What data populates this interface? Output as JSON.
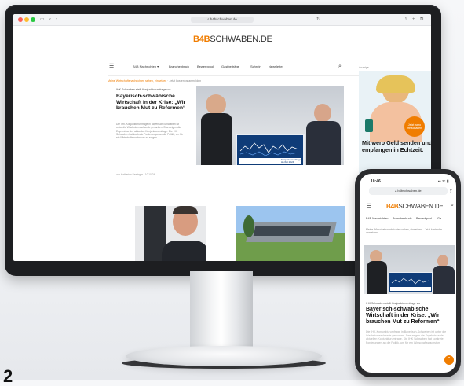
{
  "browser": {
    "url": "b4bschwaben.de"
  },
  "site": {
    "logo_mark": "B4B",
    "logo_name": "SCHWABEN.DE",
    "nav": [
      "B4B Nachrichten ▾",
      "Branchenbuch",
      "Bewerbpool",
      "Gastbeiträge",
      "Schrein",
      "Newsletter"
    ],
    "breadcrumb_highlight": "Meine Wirtschaftsnachrichten sehen, einsetzen",
    "breadcrumb_rest": "Jetzt kostenlos anmelden"
  },
  "article": {
    "kicker": "IHK Schwaben stellt Konjunkturumfrage vor",
    "headline": "Bayerisch-schwäbische Wirtschaft in der Krise: „Wir brauchen Mut zu Reformen“",
    "teaser": "Die IHK-Konjunkturumfrage in Bayerisch-Schwaben ist unter die Wachstumsschwelle gesunken. Das zeigen die Ergebnisse der aktuellen Konjunkturumfrage. Die IHK Schwaben hat konkrete Forderungen an die Politik, um für ein Wirtschaftswachstum zu sorgen.",
    "byline": "von Katharina Seelinger · 10.10.24",
    "board_caption": "Konjunkturumfrage Herbst 2024"
  },
  "ad": {
    "label": "Anzeige",
    "headline": "Mit wero Geld senden und empfangen in Echtzeit.",
    "badge": "Jetzt wero freischalten"
  },
  "phone": {
    "time": "10:46",
    "status_icons": "▪▪ ᯤ ▮",
    "url": "b4bschwaben.de",
    "nav": [
      "B4B Nachrichten",
      "Branchenbuch",
      "Bewerbpool",
      "Ga"
    ],
    "breadcrumb": "Meine Wirtschaftsnachrichten sehen, einsetzen – Jetzt kostenlos anmelden",
    "kicker": "IHK Schwaben stellt Konjunkturumfrage vor",
    "headline": "Bayerisch-schwäbische Wirtschaft in der Krise: „Wir brauchen Mut zu Reformen“",
    "teaser": "Die IHK-Konjunkturumfrage in Bayerisch-Schwaben ist unter die Wachstumsschwelle gesunken. Das zeigen die Ergebnisse der aktuellen Konjunkturumfrage. Die IHK Schwaben hat konkrete Forderungen an die Politik, um für ein Wirtschaftswachstum"
  },
  "corner_number": "2",
  "colors": {
    "brand_orange": "#f07d00",
    "board_blue": "#0f3c78",
    "bezel": "#1d1e21"
  }
}
